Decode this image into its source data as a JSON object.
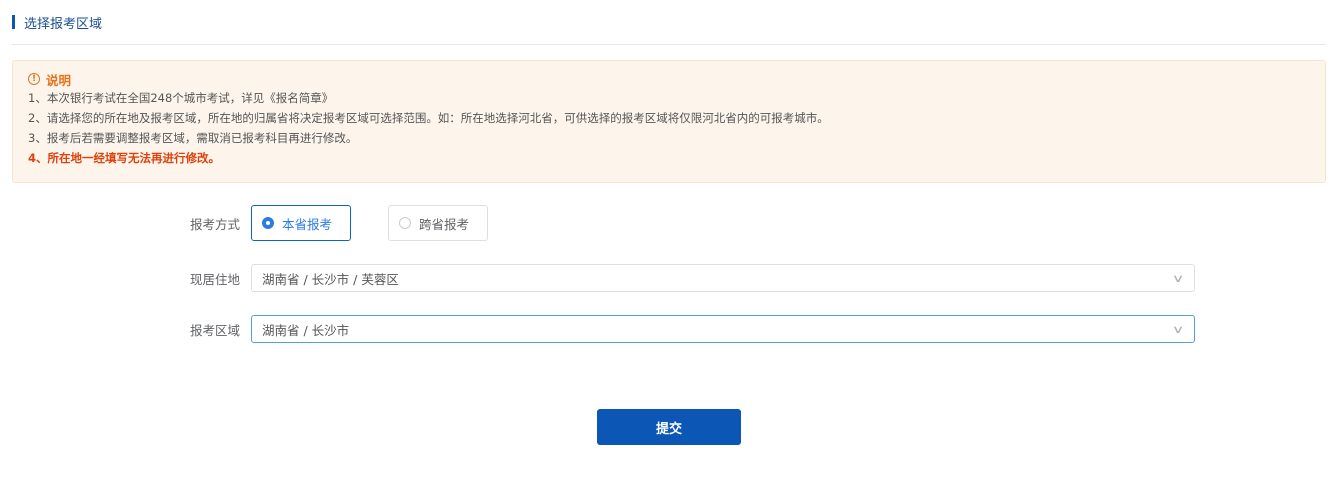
{
  "section": {
    "title": "选择报考区域"
  },
  "notice": {
    "title": "说明",
    "icon": "warning-circle-icon",
    "lines": [
      "1、本次银行考试在全国248个城市考试，详见《报名简章》",
      "2、请选择您的所在地及报考区域，所在地的归属省将决定报考区域可选择范围。如：所在地选择河北省，可供选择的报考区域将仅限河北省内的可报考城市。",
      "3、报考后若需要调整报考区域，需取消已报考科目再进行修改。",
      "4、所在地一经填写无法再进行修改。"
    ]
  },
  "form": {
    "mode": {
      "label": "报考方式",
      "options": [
        "本省报考",
        "跨省报考"
      ],
      "selected": "本省报考"
    },
    "residence": {
      "label": "现居住地",
      "value": "湖南省 / 长沙市 / 芙蓉区"
    },
    "region": {
      "label": "报考区域",
      "value": "湖南省 / 长沙市"
    }
  },
  "submit": {
    "label": "提交"
  },
  "colors": {
    "primary": "#0c56b5",
    "warning": "#e6731c",
    "emphasis": "#e0410b"
  }
}
